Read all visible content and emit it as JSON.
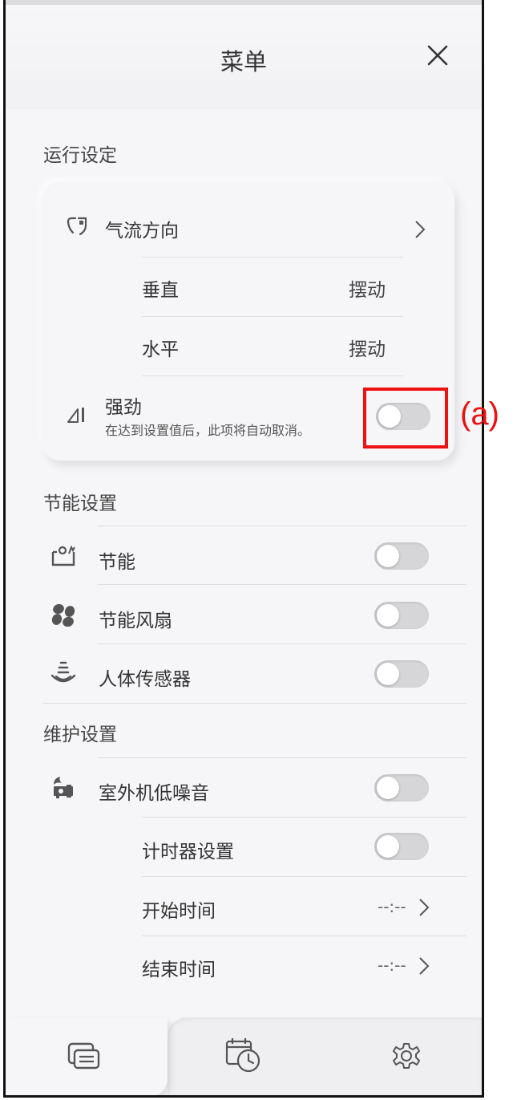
{
  "header": {
    "title": "菜单"
  },
  "sections": {
    "operation": "运行设定",
    "energy": "节能设置",
    "maintenance": "维护设置"
  },
  "airflow": {
    "label": "气流方向",
    "vertical_label": "垂直",
    "vertical_value": "摆动",
    "horizontal_label": "水平",
    "horizontal_value": "摆动"
  },
  "powerful": {
    "label": "强劲",
    "description": "在达到设置值后，此项将自动取消。",
    "enabled": false
  },
  "energy_items": [
    {
      "label": "节能",
      "enabled": false
    },
    {
      "label": "节能风扇",
      "enabled": false
    },
    {
      "label": "人体传感器",
      "enabled": false
    }
  ],
  "maintenance_items": {
    "outdoor_low_noise": {
      "label": "室外机低噪音",
      "enabled": false
    },
    "timer_setting": {
      "label": "计时器设置",
      "enabled": false
    },
    "start_time": {
      "label": "开始时间",
      "value": "--:--"
    },
    "end_time": {
      "label": "结束时间",
      "value": "--:--"
    }
  },
  "annotation": {
    "label": "(a)",
    "color": "#ee1111"
  },
  "icons": {
    "close": "close-icon",
    "airflow": "airflow-direction-icon",
    "powerful": "powerful-icon",
    "energy": "energy-saving-icon",
    "fan": "fan-icon",
    "sensor": "human-sensor-icon",
    "low_noise": "outdoor-low-noise-icon",
    "tab_menu": "menu-tab-icon",
    "tab_timer": "timer-tab-icon",
    "tab_settings": "gear-icon"
  }
}
